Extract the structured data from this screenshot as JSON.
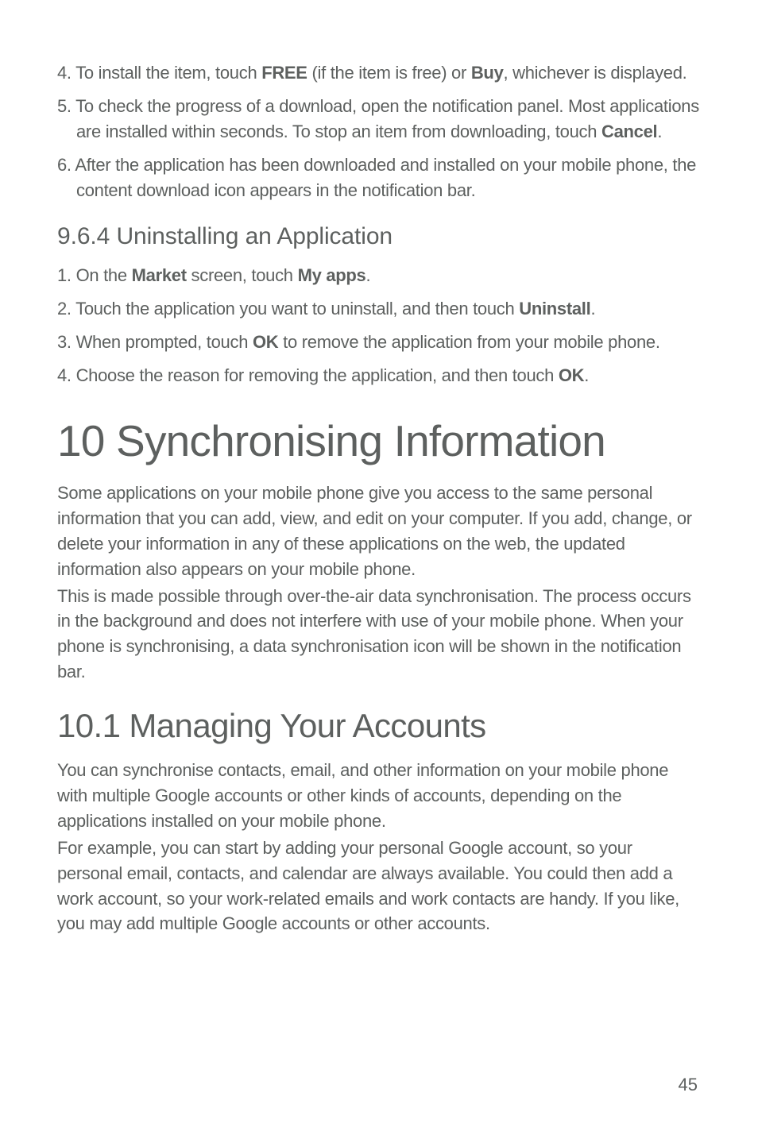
{
  "list1": {
    "item4": {
      "num": "4.",
      "pre": "To install the item, touch ",
      "b1": "FREE",
      "mid": " (if the item is free) or ",
      "b2": "Buy",
      "post": ", whichever is displayed."
    },
    "item5": {
      "num": "5.",
      "pre": "To check the progress of a download, open the notification panel. Most applications are installed within seconds. To stop an item from downloading, touch ",
      "b1": "Cancel",
      "post": "."
    },
    "item6": {
      "num": "6.",
      "text": "After the application has been downloaded and installed on your mobile phone, the content download icon appears in the notification bar."
    }
  },
  "section964": {
    "heading": "9.6.4   Uninstalling an Application",
    "item1": {
      "num": "1.",
      "pre": "On the ",
      "b1": "Market",
      "mid": " screen, touch ",
      "b2": "My apps",
      "post": "."
    },
    "item2": {
      "num": "2.",
      "pre": "Touch the application you want to uninstall, and then touch ",
      "b1": "Uninstall",
      "post": "."
    },
    "item3": {
      "num": "3.",
      "pre": "When prompted, touch ",
      "b1": "OK",
      "post": " to remove the application from your mobile phone."
    },
    "item4": {
      "num": "4.",
      "pre": "Choose the reason for removing the application, and then touch ",
      "b1": "OK",
      "post": "."
    }
  },
  "chapter10": {
    "heading": "10  Synchronising Information",
    "para1": "Some applications on your mobile phone give you access to the same personal information that you can add, view, and edit on your computer. If you add, change, or delete your information in any of these applications on the web, the updated information also appears on your mobile phone.",
    "para2": "This is made possible through over-the-air data synchronisation. The process occurs in the background and does not interfere with use of your mobile phone. When your phone is synchronising, a data synchronisation icon will be shown in the notification bar."
  },
  "section101": {
    "heading": "10.1  Managing Your Accounts",
    "para1": "You can synchronise contacts, email, and other information on your mobile phone with multiple Google accounts or other kinds of accounts, depending on the applications installed on your mobile phone.",
    "para2": "For example, you can start by adding your personal Google account, so your personal email, contacts, and calendar are always available. You could then add a work account, so your work-related emails and work contacts are handy. If you like, you may add multiple Google accounts or other accounts."
  },
  "pageNumber": "45"
}
